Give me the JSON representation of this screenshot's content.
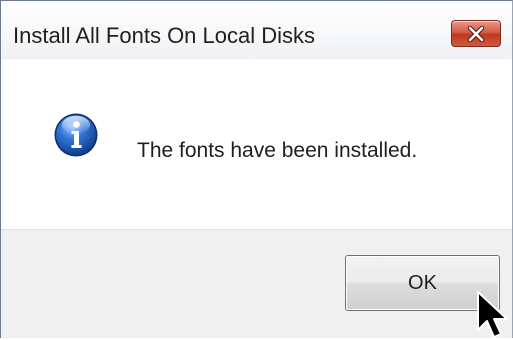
{
  "window": {
    "title": "Install All Fonts On Local Disks",
    "close_icon": "close-x-icon"
  },
  "content": {
    "icon": "info-icon",
    "message": "The fonts have been installed."
  },
  "footer": {
    "ok_label": "OK"
  },
  "colors": {
    "close_button": "#c94a33",
    "info_icon": "#1f5fc0",
    "footer_background": "#f0f0f0"
  }
}
